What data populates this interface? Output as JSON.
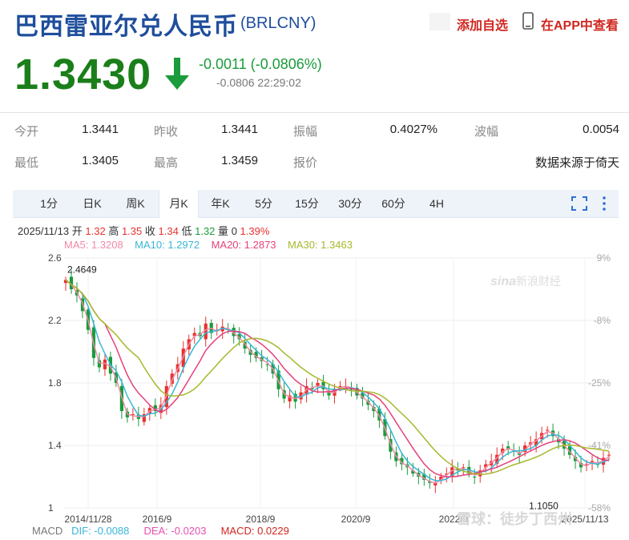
{
  "header": {
    "title": "巴西雷亚尔兑人民币",
    "code": "(BRLCNY)",
    "add_favorite": "添加自选",
    "view_in_app": "在APP中查看"
  },
  "quote": {
    "price": "1.3430",
    "change": "-0.0011 (-0.0806%)",
    "sub_line": "-0.0806 22:29:02"
  },
  "stats": {
    "open_label": "今开",
    "open": "1.3441",
    "prev_close_label": "昨收",
    "prev_close": "1.3441",
    "amplitude_label": "振幅",
    "amplitude": "0.4027%",
    "spread_label": "波幅",
    "spread": "0.0054",
    "low_label": "最低",
    "low": "1.3405",
    "high_label": "最高",
    "high": "1.3459",
    "quote_label": "报价",
    "source": "数据来源于倚天"
  },
  "tabs": [
    "1分",
    "日K",
    "周K",
    "月K",
    "年K",
    "5分",
    "15分",
    "30分",
    "60分",
    "4H"
  ],
  "active_tab": "月K",
  "info": {
    "date": "2025/11/13",
    "open_label": "开",
    "open": "1.32",
    "high_label": "高",
    "high": "1.35",
    "close_label": "收",
    "close": "1.34",
    "low_label": "低",
    "low": "1.32",
    "vol_label": "量",
    "vol": "0",
    "pct": "1.39%"
  },
  "ma": {
    "ma5": "MA5: 1.3208",
    "ma10": "MA10: 1.2972",
    "ma20": "MA20: 1.2873",
    "ma30": "MA30: 1.3463"
  },
  "macd": {
    "label": "MACD",
    "dif": "DIF: -0.0088",
    "dea": "DEA: -0.0203",
    "macd": "MACD: 0.0229"
  },
  "watermark": "雪球：徒步丁西州",
  "logo_text": "新浪财经",
  "colors": {
    "up": "#e8322e",
    "down": "#1a9b3c",
    "ma5": "#f08aa8",
    "ma10": "#38b6d8",
    "ma20": "#e6407a",
    "ma30": "#a8b82c",
    "title": "#1f4e9c"
  },
  "chart_data": {
    "type": "candlestick",
    "x_ticks": [
      "2014/11/28",
      "2016/9",
      "2018/9",
      "2020/9",
      "2022/9",
      "2025/11/13"
    ],
    "y_ticks": [
      "2.6",
      "2.2",
      "1.8",
      "1.4",
      "1"
    ],
    "y_range": [
      1.0,
      2.6
    ],
    "pct_ticks": [
      "9%",
      "-8%",
      "-25%",
      "-41%",
      "-58%"
    ],
    "annotations": [
      {
        "label": "2.4649",
        "value": 2.4649,
        "index": 0
      },
      {
        "label": "1.1050",
        "value": 1.105,
        "index": 87
      }
    ],
    "closes": [
      2.46,
      2.4,
      2.36,
      2.26,
      2.14,
      1.96,
      1.9,
      1.95,
      1.86,
      1.8,
      1.62,
      1.58,
      1.6,
      1.57,
      1.6,
      1.64,
      1.62,
      1.66,
      1.78,
      1.86,
      1.92,
      2.02,
      2.08,
      2.12,
      2.1,
      2.18,
      2.12,
      2.14,
      2.16,
      2.14,
      2.1,
      2.08,
      2.02,
      1.98,
      1.96,
      1.94,
      1.92,
      1.86,
      1.76,
      1.7,
      1.72,
      1.68,
      1.74,
      1.78,
      1.76,
      1.8,
      1.76,
      1.72,
      1.76,
      1.78,
      1.78,
      1.76,
      1.72,
      1.7,
      1.66,
      1.62,
      1.56,
      1.46,
      1.36,
      1.3,
      1.28,
      1.26,
      1.22,
      1.2,
      1.18,
      1.16,
      1.16,
      1.2,
      1.22,
      1.26,
      1.24,
      1.26,
      1.22,
      1.2,
      1.24,
      1.28,
      1.3,
      1.34,
      1.38,
      1.38,
      1.36,
      1.34,
      1.4,
      1.42,
      1.44,
      1.48,
      1.5,
      1.46,
      1.42,
      1.38,
      1.34,
      1.3,
      1.26,
      1.28,
      1.3,
      1.28,
      1.32,
      1.34
    ]
  }
}
